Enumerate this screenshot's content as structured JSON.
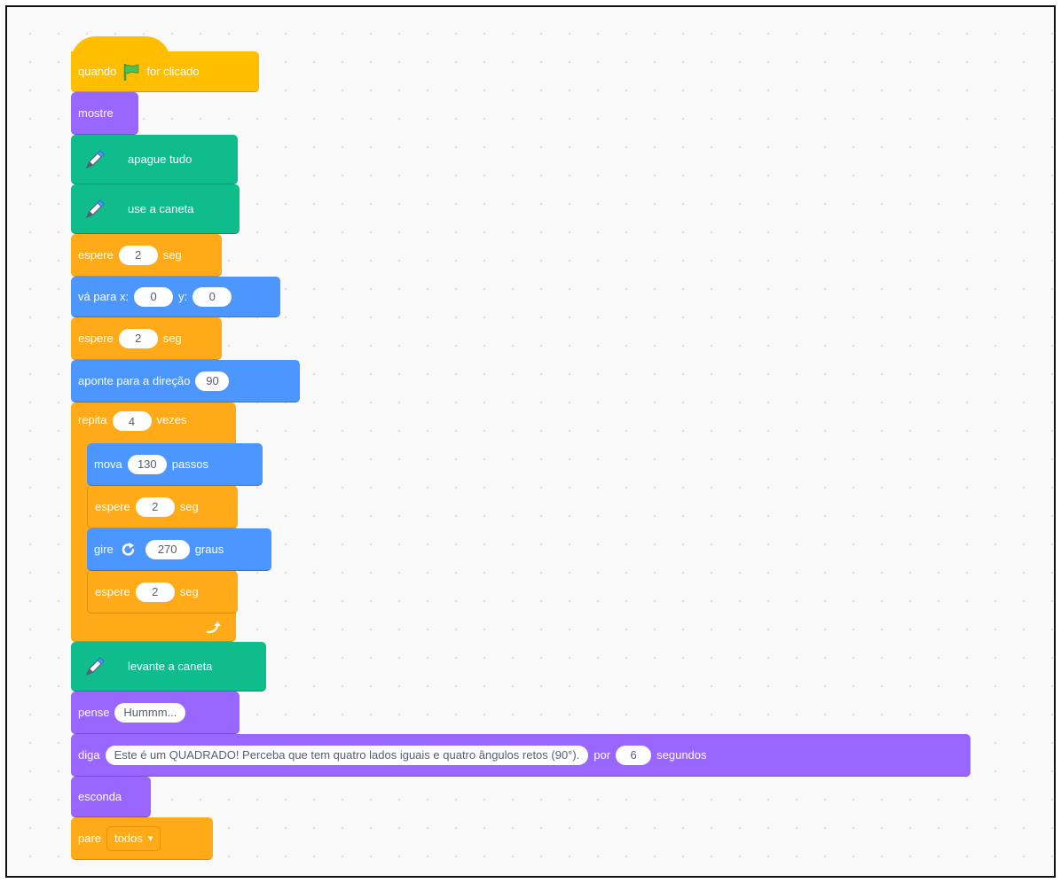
{
  "colors": {
    "events": "#ffbf00",
    "control": "#ffab19",
    "looks": "#9966ff",
    "pen": "#0fbd8c",
    "motion": "#4c97ff"
  },
  "hat": {
    "word1": "quando",
    "icon": "green-flag-icon",
    "word2": "for clicado"
  },
  "show": {
    "label": "mostre"
  },
  "clear": {
    "icon": "pen-icon",
    "label": "apague tudo"
  },
  "pen_down": {
    "icon": "pen-icon",
    "label": "use a caneta"
  },
  "wait1": {
    "label": "espere",
    "value": "2",
    "unit": "seg"
  },
  "goto": {
    "label": "vá para x:",
    "x": "0",
    "ylabel": "y:",
    "y": "0"
  },
  "wait2": {
    "label": "espere",
    "value": "2",
    "unit": "seg"
  },
  "point": {
    "label": "aponte para a direção",
    "value": "90"
  },
  "repeat": {
    "label": "repita",
    "value": "4",
    "unit": "vezes",
    "end_icon": "loop-arrow-icon"
  },
  "move": {
    "label": "mova",
    "value": "130",
    "unit": "passos"
  },
  "wait3": {
    "label": "espere",
    "value": "2",
    "unit": "seg"
  },
  "turn": {
    "label": "gire",
    "icon": "rotate-right-icon",
    "value": "270",
    "unit": "graus"
  },
  "wait4": {
    "label": "espere",
    "value": "2",
    "unit": "seg"
  },
  "pen_up": {
    "icon": "pen-icon",
    "label": "levante a caneta"
  },
  "think": {
    "label": "pense",
    "value": "Hummm..."
  },
  "say": {
    "label": "diga",
    "value": "Este é um QUADRADO! Perceba que tem quatro lados iguais e quatro ângulos retos (90°).",
    "mid": "por",
    "secs": "6",
    "unit": "segundos"
  },
  "hide": {
    "label": "esconda"
  },
  "stop": {
    "label": "pare",
    "option": "todos",
    "arrow": "▾"
  }
}
